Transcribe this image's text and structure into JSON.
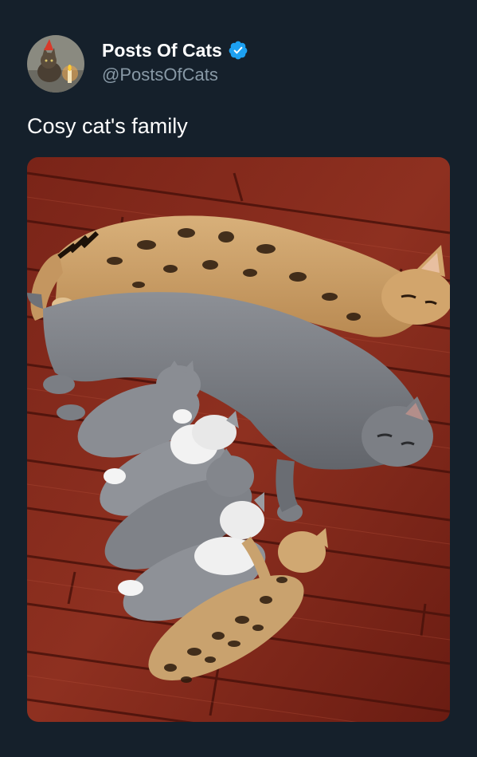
{
  "author": {
    "display_name": "Posts Of Cats",
    "handle": "@PostsOfCats",
    "verified": true,
    "avatar_icon": "cat-with-party-hat-avatar"
  },
  "tweet": {
    "text": "Cosy cat's family"
  },
  "colors": {
    "background": "#15202b",
    "text_primary": "#ffffff",
    "text_secondary": "#8899a6",
    "verified_blue": "#1da1f2"
  }
}
